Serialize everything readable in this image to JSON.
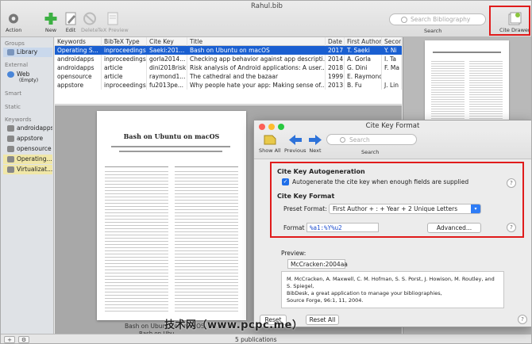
{
  "window": {
    "title": "Rahul.bib"
  },
  "toolbar": {
    "action": "Action",
    "new": "New",
    "edit": "Edit",
    "delete": "Delete",
    "tex_preview": "TeX Preview",
    "search_placeholder": "Search Bibliography",
    "search_label": "Search",
    "cite_drawer": "Cite Drawer"
  },
  "sidebar": {
    "groups_header": "Groups",
    "library": "Library",
    "external_header": "External",
    "web": "Web",
    "web_sub": "(Empty)",
    "smart_header": "Smart",
    "static_header": "Static",
    "keywords_header": "Keywords",
    "keywords": [
      "androidapps",
      "appstore",
      "opensource",
      "Operating...",
      "Virtualizat..."
    ]
  },
  "table": {
    "columns": [
      "Keywords",
      "BibTeX Type",
      "Cite Key",
      "Title",
      "Date",
      "First Author",
      "Secon"
    ],
    "rows": [
      [
        "Operating S...",
        "inproceedings",
        "Saeki:201...",
        "Bash on Ubuntu on macOS",
        "2017",
        "T. Saeki",
        "Y. Ni"
      ],
      [
        "androidapps",
        "inproceedings",
        "gorla2014...",
        "Checking app behavior against app descripti...",
        "2014",
        "A. Gorla",
        "I. Ta"
      ],
      [
        "androidapps",
        "article",
        "dini2018risk",
        "Risk analysis of Android applications: A user...",
        "2018",
        "G. Dini",
        "F. Ma"
      ],
      [
        "opensource",
        "article",
        "raymond1...",
        "The cathedral and the bazaar",
        "1999",
        "E. Raymond",
        ""
      ],
      [
        "appstore",
        "inproceedings",
        "fu2013pe...",
        "Why people hate your app: Making sense of...",
        "2013",
        "B. Fu",
        "J. Lin"
      ]
    ]
  },
  "preview": {
    "paper_title": "Bash on Ubuntu on macOS",
    "caption": "Bash on Ubuntu on macOS",
    "caption2": "Bash on Ubu..."
  },
  "status": {
    "count": "5 publications"
  },
  "dialog": {
    "title": "Cite Key Format",
    "show_all": "Show All",
    "previous": "Previous",
    "next": "Next",
    "search_placeholder": "Search",
    "search_label": "Search",
    "autogen_heading": "Cite Key Autogeneration",
    "autogen_checkbox": "Autogenerate the cite key when enough fields are supplied",
    "format_heading": "Cite Key Format",
    "preset_label": "Preset Format:",
    "preset_value": "First Author + : + Year + 2 Unique Letters",
    "format_label": "Format String:",
    "format_value": "%a1:%Y%u2",
    "advanced": "Advanced...",
    "preview_label": "Preview:",
    "preview_value": "McCracken:2004aa",
    "citation_lines": [
      "M. McCracken, A. Maxwell, C. M. Hofman, S. S. Porst, J. Howison, M. Routley, and S. Spiegel,",
      "BibDesk, a great application to manage your bibliographies,",
      "Source Forge, 96:1, 11, 2004."
    ],
    "reset": "Reset",
    "reset_all": "Reset All"
  },
  "watermark": "技术网（www.pcpc.me）",
  "colors": {
    "selection": "#1a5fd1",
    "highlight_box": "#e01b1b",
    "new_icon": "#3cb043"
  }
}
